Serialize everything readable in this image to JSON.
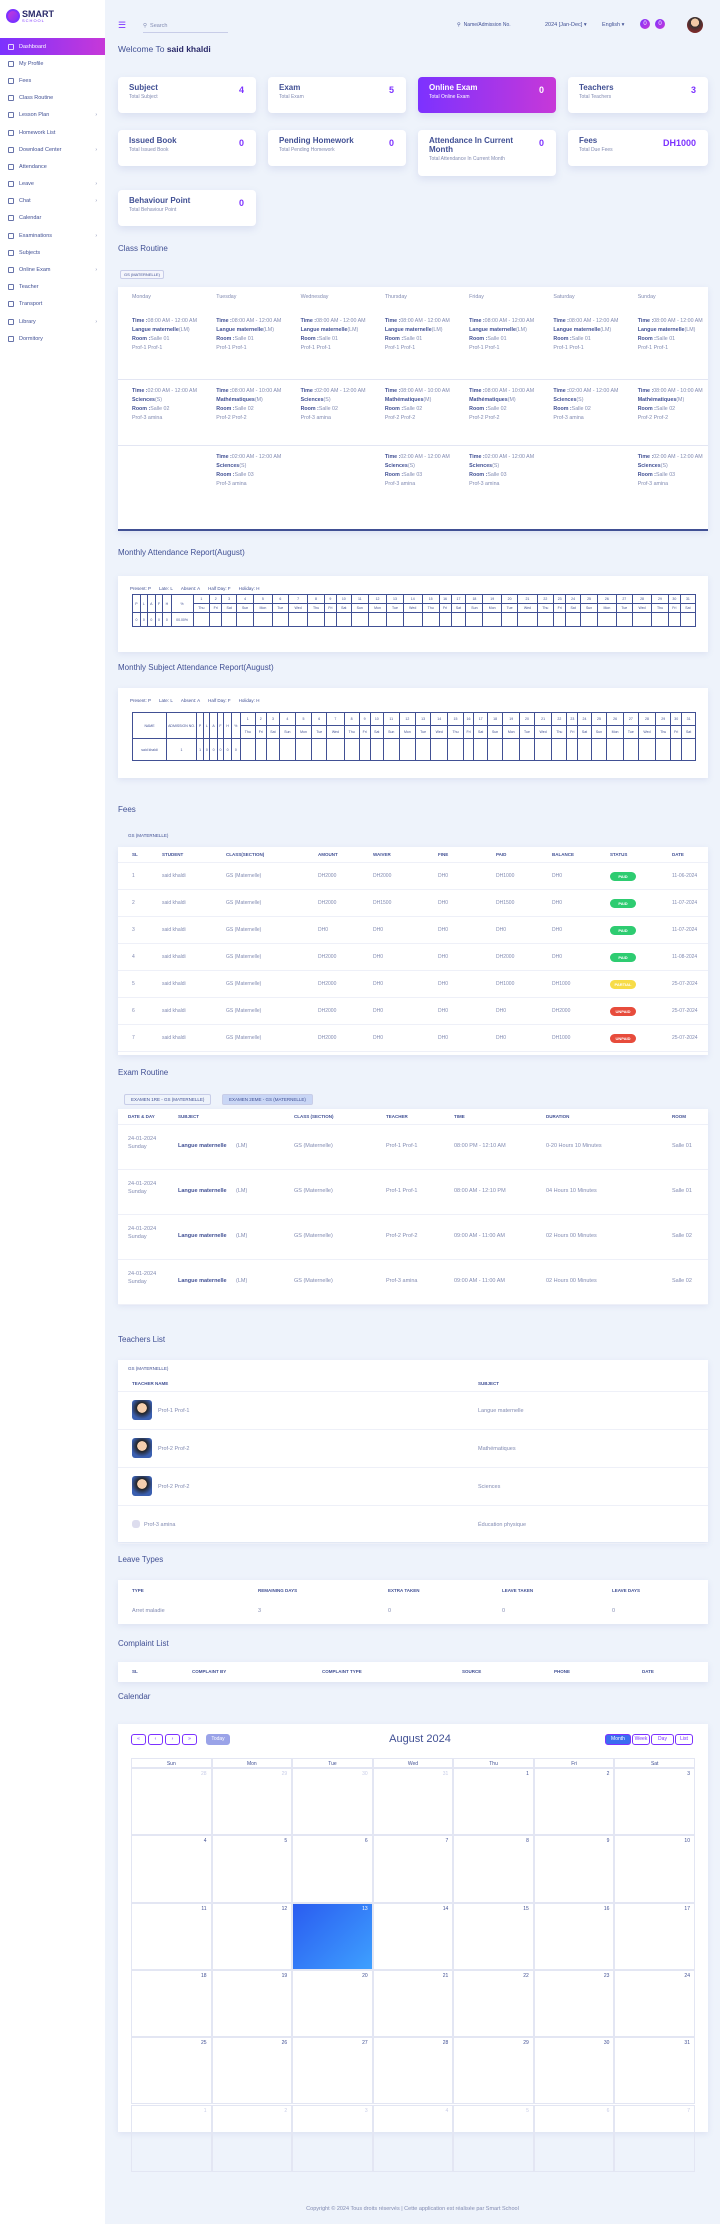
{
  "brand": {
    "line1": "SMART",
    "line2": "SCHOOL"
  },
  "sidebar": [
    {
      "label": "Dashboard",
      "active": true
    },
    {
      "label": "My Profile"
    },
    {
      "label": "Fees"
    },
    {
      "label": "Class Routine"
    },
    {
      "label": "Lesson Plan",
      "chev": true
    },
    {
      "label": "Homework List"
    },
    {
      "label": "Download Center",
      "chev": true
    },
    {
      "label": "Attendance"
    },
    {
      "label": "Leave",
      "chev": true
    },
    {
      "label": "Chat",
      "chev": true
    },
    {
      "label": "Calendar"
    },
    {
      "label": "Examinations",
      "chev": true
    },
    {
      "label": "Subjects"
    },
    {
      "label": "Online Exam",
      "chev": true
    },
    {
      "label": "Teacher"
    },
    {
      "label": "Transport"
    },
    {
      "label": "Library",
      "chev": true
    },
    {
      "label": "Dormitory"
    }
  ],
  "topbar": {
    "search": "Search",
    "sch_adm": "Name/Admission No.",
    "session": "2024 [Jan-Dec]",
    "language": "English",
    "bell_count": "0",
    "msg_count": "0"
  },
  "welcome": {
    "prefix": "Welcome To ",
    "name": "said khaldi"
  },
  "cards": [
    {
      "title": "Subject",
      "sub": "Total Subject",
      "value": "4"
    },
    {
      "title": "Exam",
      "sub": "Total Exam",
      "value": "5"
    },
    {
      "title": "Online Exam",
      "sub": "Total Online Exam",
      "value": "0"
    },
    {
      "title": "Teachers",
      "sub": "Total Teachers",
      "value": "3"
    },
    {
      "title": "Issued Book",
      "sub": "Total Issued Book",
      "value": "0"
    },
    {
      "title": "Pending Homework",
      "sub": "Total Pending Homework",
      "value": "0"
    },
    {
      "title": "Attendance In Current Month",
      "sub": "Total Attendance In Current Month",
      "value": "0"
    },
    {
      "title": "Fees",
      "sub": "Total Due Fees",
      "value": "DH1000"
    },
    {
      "title": "Behaviour Point",
      "sub": "Total Behaviour Point",
      "value": "0"
    }
  ],
  "sections": {
    "routine": "Class Routine",
    "monthly": "Monthly Attendance Report(August)",
    "subject_att": "Monthly Subject Attendance Report(August)",
    "fees": "Fees",
    "exam": "Exam Routine",
    "teachers": "Teachers List",
    "leave": "Leave Types",
    "complaint": "Complaint List",
    "calendar": "Calendar"
  },
  "class_tag": "GS (MATERNELLE)",
  "routine": {
    "days": [
      "Monday",
      "Tuesday",
      "Wednesday",
      "Thursday",
      "Friday",
      "Saturday",
      "Sunday"
    ],
    "time_lbl": "Time :",
    "room_lbl": "Room :",
    "rows": [
      [
        {
          "time": "08:00 AM - 12:00 AM",
          "subj": "Langue maternelle",
          "code": "(LM)",
          "room": "Salle 01",
          "teacher": "Prof-1 Prof-1"
        },
        {
          "time": "08:00 AM - 12:00 AM",
          "subj": "Langue maternelle",
          "code": "(LM)",
          "room": "Salle 01",
          "teacher": "Prof-1 Prof-1"
        },
        {
          "time": "08:00 AM - 12:00 AM",
          "subj": "Langue maternelle",
          "code": "(LM)",
          "room": "Salle 01",
          "teacher": "Prof-1 Prof-1"
        },
        {
          "time": "08:00 AM - 12:00 AM",
          "subj": "Langue maternelle",
          "code": "(LM)",
          "room": "Salle 01",
          "teacher": "Prof-1 Prof-1"
        },
        {
          "time": "08:00 AM - 12:00 AM",
          "subj": "Langue maternelle",
          "code": "(LM)",
          "room": "Salle 01",
          "teacher": "Prof-1 Prof-1"
        },
        {
          "time": "08:00 AM - 12:00 AM",
          "subj": "Langue maternelle",
          "code": "(LM)",
          "room": "Salle 01",
          "teacher": "Prof-1 Prof-1"
        },
        {
          "time": "08:00 AM - 12:00 AM",
          "subj": "Langue maternelle",
          "code": "(LM)",
          "room": "Salle 01",
          "teacher": "Prof-1 Prof-1"
        }
      ],
      [
        {
          "time": "02:00 AM - 12:00 AM",
          "subj": "Sciences",
          "code": "(S)",
          "room": "Salle 02",
          "teacher": "Prof-3 amina"
        },
        {
          "time": "08:00 AM - 10:00 AM",
          "subj": "Mathématiques",
          "code": "(M)",
          "room": "Salle 02",
          "teacher": "Prof-2 Prof-2"
        },
        {
          "time": "02:00 AM - 12:00 AM",
          "subj": "Sciences",
          "code": "(S)",
          "room": "Salle 02",
          "teacher": "Prof-3 amina"
        },
        {
          "time": "08:00 AM - 10:00 AM",
          "subj": "Mathématiques",
          "code": "(M)",
          "room": "Salle 02",
          "teacher": "Prof-2 Prof-2"
        },
        {
          "time": "08:00 AM - 10:00 AM",
          "subj": "Mathématiques",
          "code": "(M)",
          "room": "Salle 02",
          "teacher": "Prof-2 Prof-2"
        },
        {
          "time": "02:00 AM - 12:00 AM",
          "subj": "Sciences",
          "code": "(S)",
          "room": "Salle 02",
          "teacher": "Prof-3 amina"
        },
        {
          "time": "08:00 AM - 10:00 AM",
          "subj": "Mathématiques",
          "code": "(M)",
          "room": "Salle 02",
          "teacher": "Prof-2 Prof-2"
        }
      ],
      [
        null,
        {
          "time": "02:00 AM - 12:00 AM",
          "subj": "Sciences",
          "code": "(S)",
          "room": "Salle 03",
          "teacher": "Prof-3 amina"
        },
        null,
        {
          "time": "02:00 AM - 12:00 AM",
          "subj": "Sciences",
          "code": "(S)",
          "room": "Salle 03",
          "teacher": "Prof-3 amina"
        },
        {
          "time": "02:00 AM - 12:00 AM",
          "subj": "Sciences",
          "code": "(S)",
          "room": "Salle 03",
          "teacher": "Prof-3 amina"
        },
        null,
        {
          "time": "02:00 AM - 12:00 AM",
          "subj": "Sciences",
          "code": "(S)",
          "room": "Salle 03",
          "teacher": "Prof-3 amina"
        }
      ]
    ]
  },
  "legend": [
    {
      "k": "Present",
      "v": "P"
    },
    {
      "k": "Late",
      "v": "L"
    },
    {
      "k": "Absent",
      "v": "A"
    },
    {
      "k": "Half Day",
      "v": "F"
    },
    {
      "k": "Holiday",
      "v": "H"
    }
  ],
  "att_heads": [
    "P",
    "L",
    "A",
    "F",
    "H",
    "%"
  ],
  "att_vals": [
    "0",
    "0",
    "0",
    "0",
    "0",
    "00.00%"
  ],
  "days_num": [
    "1",
    "2",
    "3",
    "4",
    "5",
    "6",
    "7",
    "8",
    "9",
    "10",
    "11",
    "12",
    "13",
    "14",
    "15",
    "16",
    "17",
    "18",
    "19",
    "20",
    "21",
    "22",
    "23",
    "24",
    "25",
    "26",
    "27",
    "28",
    "29",
    "30",
    "31"
  ],
  "days_wk": [
    "Thu",
    "Fri",
    "Sat",
    "Sun",
    "Mon",
    "Tue",
    "Wed",
    "Thu",
    "Fri",
    "Sat",
    "Sun",
    "Mon",
    "Tue",
    "Wed",
    "Thu",
    "Fri",
    "Sat",
    "Sun",
    "Mon",
    "Tue",
    "Wed",
    "Thu",
    "Fri",
    "Sat",
    "Sun",
    "Mon",
    "Tue",
    "Wed",
    "Thu",
    "Fri",
    "Sat"
  ],
  "subj_att": {
    "name_h": "NAME",
    "adm_h": "ADMISSION NO.",
    "heads": [
      "P",
      "L",
      "A",
      "F",
      "H",
      "%"
    ],
    "row": {
      "name": "said khaldi",
      "adm": "1",
      "vals": [
        "1",
        "0",
        "0",
        "0",
        "0",
        "0",
        "1",
        "00%"
      ]
    }
  },
  "fees": {
    "heads": [
      "SL",
      "STUDENT",
      "CLASS(SECTION)",
      "AMOUNT",
      "WAIVER",
      "FINE",
      "PAID",
      "BALANCE",
      "STATUS",
      "DATE"
    ],
    "rows": [
      [
        "1",
        "said khaldi",
        "GS (Maternelle)",
        "DH2000",
        "DH2000",
        "DH0",
        "DH1000",
        "DH0",
        "PAID",
        "11-06-2024",
        "paid"
      ],
      [
        "2",
        "said khaldi",
        "GS (Maternelle)",
        "DH2000",
        "DH1500",
        "DH0",
        "DH1500",
        "DH0",
        "PAID",
        "11-07-2024",
        "paid"
      ],
      [
        "3",
        "said khaldi",
        "GS (Maternelle)",
        "DH0",
        "DH0",
        "DH0",
        "DH0",
        "DH0",
        "PAID",
        "11-07-2024",
        "paid"
      ],
      [
        "4",
        "said khaldi",
        "GS (Maternelle)",
        "DH2000",
        "DH0",
        "DH0",
        "DH2000",
        "DH0",
        "PAID",
        "11-08-2024",
        "paid"
      ],
      [
        "5",
        "said khaldi",
        "GS (Maternelle)",
        "DH2000",
        "DH0",
        "DH0",
        "DH1000",
        "DH1000",
        "PARTIAL",
        "25-07-2024",
        "partial"
      ],
      [
        "6",
        "said khaldi",
        "GS (Maternelle)",
        "DH2000",
        "DH0",
        "DH0",
        "DH0",
        "DH2000",
        "UNPAID",
        "25-07-2024",
        "unpaid"
      ],
      [
        "7",
        "said khaldi",
        "GS (Maternelle)",
        "DH2000",
        "DH0",
        "DH0",
        "DH0",
        "DH1000",
        "UNPAID",
        "25-07-2024",
        "unpaid"
      ]
    ]
  },
  "exam": {
    "tabs": [
      "EXAMEN 1RE - GS (MATERNELLE)",
      "EXAMEN 2EME - GS (MATERNELLE)"
    ],
    "heads": [
      "DATE & DAY",
      "SUBJECT",
      "CLASS (SECTION)",
      "TEACHER",
      "TIME",
      "DURATION",
      "ROOM"
    ],
    "rows": [
      {
        "date": "24-01-2024",
        "day": "Sunday",
        "subj": "Langue maternelle",
        "code": "(LM)",
        "cls": "GS (Maternelle)",
        "teacher": "Prof-1 Prof-1",
        "time": "08:00 PM - 12:10 AM",
        "dur": "0-20 Hours 10 Minutes",
        "room": "Salle 01"
      },
      {
        "date": "24-01-2024",
        "day": "Sunday",
        "subj": "Langue maternelle",
        "code": "(LM)",
        "cls": "GS (Maternelle)",
        "teacher": "Prof-1 Prof-1",
        "time": "08:00 AM - 12:10 PM",
        "dur": "04 Hours 10 Minutes",
        "room": "Salle 01"
      },
      {
        "date": "24-01-2024",
        "day": "Sunday",
        "subj": "Langue maternelle",
        "code": "(LM)",
        "cls": "GS (Maternelle)",
        "teacher": "Prof-2 Prof-2",
        "time": "09:00 AM - 11:00 AM",
        "dur": "02 Hours 00 Minutes",
        "room": "Salle 02"
      },
      {
        "date": "24-01-2024",
        "day": "Sunday",
        "subj": "Langue maternelle",
        "code": "(LM)",
        "cls": "GS (Maternelle)",
        "teacher": "Prof-3 amina",
        "time": "09:00 AM - 11:00 AM",
        "dur": "02 Hours 00 Minutes",
        "room": "Salle 02"
      }
    ]
  },
  "teachers": {
    "h1": "TEACHER NAME",
    "h2": "SUBJECT",
    "rows": [
      [
        "Prof-1 Prof-1",
        "Langue maternelle"
      ],
      [
        "Prof-2 Prof-2",
        "Mathématiques"
      ],
      [
        "Prof-2 Prof-2",
        "Sciences"
      ],
      [
        "Prof-3 amina",
        "Éducation physique"
      ]
    ]
  },
  "leave": {
    "heads": [
      "TYPE",
      "REMAINING DAYS",
      "EXTRA TAKEN",
      "LEAVE TAKEN",
      "LEAVE DAYS"
    ],
    "row": [
      "Arret maladie",
      "3",
      "0",
      "0",
      "0"
    ]
  },
  "complaint": {
    "heads": [
      "SL",
      "COMPLAINT BY",
      "COMPLAINT TYPE",
      "SOURCE",
      "PHONE",
      "DATE"
    ]
  },
  "calendar": {
    "title": "August 2024",
    "today": "Today",
    "views": [
      "Month",
      "Week",
      "Day",
      "List"
    ],
    "nav": [
      "«",
      "‹",
      "›",
      "»"
    ],
    "days": [
      "Sun",
      "Mon",
      "Tue",
      "Wed",
      "Thu",
      "Fri",
      "Sat"
    ],
    "weeks": [
      [
        "28",
        "29",
        "30",
        "31",
        "1",
        "2",
        "3"
      ],
      [
        "4",
        "5",
        "6",
        "7",
        "8",
        "9",
        "10"
      ],
      [
        "11",
        "12",
        "13",
        "14",
        "15",
        "16",
        "17"
      ],
      [
        "18",
        "19",
        "20",
        "21",
        "22",
        "23",
        "24"
      ],
      [
        "25",
        "26",
        "27",
        "28",
        "29",
        "30",
        "31"
      ],
      [
        "1",
        "2",
        "3",
        "4",
        "5",
        "6",
        "7"
      ]
    ]
  },
  "footer": "Copyright © 2024 Tous droits réservés | Cette application est réalisée par Smart School"
}
